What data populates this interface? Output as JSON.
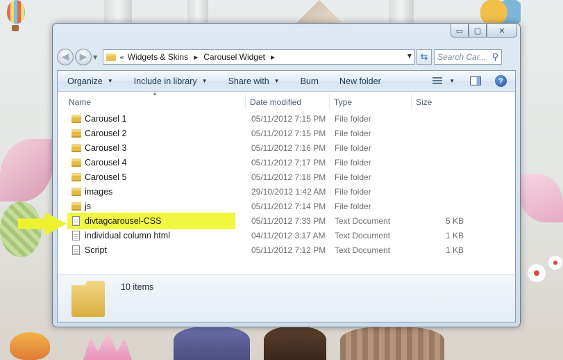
{
  "window": {
    "caption_buttons": {
      "minimize": "▭",
      "maximize": "▢",
      "close": "✕"
    }
  },
  "nav": {
    "back_icon": "back-arrow-icon",
    "forward_icon": "forward-arrow-icon",
    "address_prefix": "«",
    "breadcrumb": [
      "Widgets & Skins",
      "Carousel Widget"
    ],
    "search_placeholder": "Search Car..."
  },
  "toolbar": {
    "organize": "Organize",
    "include_in_library": "Include in library",
    "share_with": "Share with",
    "burn": "Burn",
    "new_folder": "New folder"
  },
  "columns": {
    "name": "Name",
    "date_modified": "Date modified",
    "type": "Type",
    "size": "Size"
  },
  "files": [
    {
      "name": "Carousel 1",
      "date": "05/11/2012 7:15 PM",
      "type": "File folder",
      "size": "",
      "kind": "folder"
    },
    {
      "name": "Carousel 2",
      "date": "05/11/2012 7:15 PM",
      "type": "File folder",
      "size": "",
      "kind": "folder"
    },
    {
      "name": "Carousel 3",
      "date": "05/11/2012 7:16 PM",
      "type": "File folder",
      "size": "",
      "kind": "folder"
    },
    {
      "name": "Carousel 4",
      "date": "05/11/2012 7:17 PM",
      "type": "File folder",
      "size": "",
      "kind": "folder"
    },
    {
      "name": "Carousel 5",
      "date": "05/11/2012 7:18 PM",
      "type": "File folder",
      "size": "",
      "kind": "folder"
    },
    {
      "name": "images",
      "date": "29/10/2012 1:42 AM",
      "type": "File folder",
      "size": "",
      "kind": "folder"
    },
    {
      "name": "js",
      "date": "05/11/2012 7:14 PM",
      "type": "File folder",
      "size": "",
      "kind": "folder"
    },
    {
      "name": "divtagcarousel-CSS",
      "date": "05/11/2012 7:33 PM",
      "type": "Text Document",
      "size": "5 KB",
      "kind": "doc",
      "highlighted": true
    },
    {
      "name": "individual column html",
      "date": "04/11/2012 3:17 AM",
      "type": "Text Document",
      "size": "1 KB",
      "kind": "doc"
    },
    {
      "name": "Script",
      "date": "05/11/2012 7:12 PM",
      "type": "Text Document",
      "size": "1 KB",
      "kind": "doc"
    }
  ],
  "status": {
    "item_count": "10 items"
  },
  "colors": {
    "highlight": "#f0f73f",
    "pointer_arrow": "#ecf22f",
    "folder": "#e3bb45",
    "toolbar_text": "#1d3858"
  }
}
